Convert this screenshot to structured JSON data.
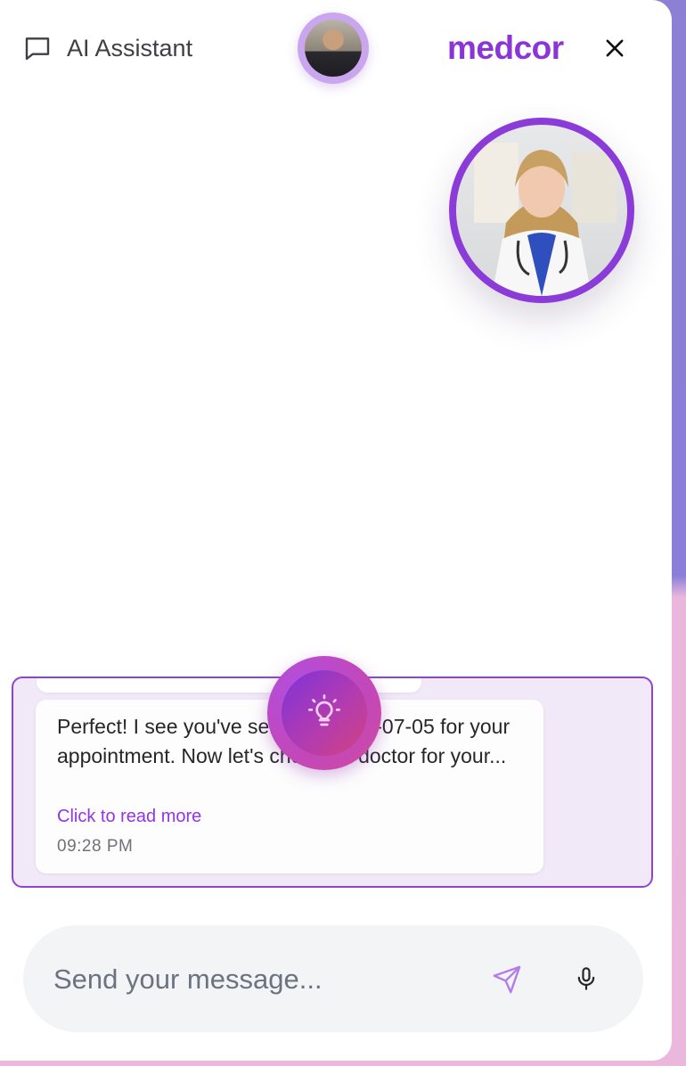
{
  "header": {
    "title": "AI Assistant",
    "brand": "medcor",
    "icons": {
      "chat": "chat-bubble-icon",
      "close": "close-icon"
    }
  },
  "message": {
    "text": "Perfect! I see you've selected 2025-07-05 for your appointment. Now let's choose a doctor for your...",
    "read_more": "Click to read more",
    "time": "09:28 PM"
  },
  "composer": {
    "placeholder": "Send your message...",
    "icons": {
      "send": "send-icon",
      "mic": "microphone-icon",
      "idea": "lightbulb-icon"
    }
  },
  "colors": {
    "brand": "#8b35d6",
    "accent_border": "#8e44d9",
    "message_area_bg": "#f1e8f8",
    "link": "#9333ea"
  }
}
